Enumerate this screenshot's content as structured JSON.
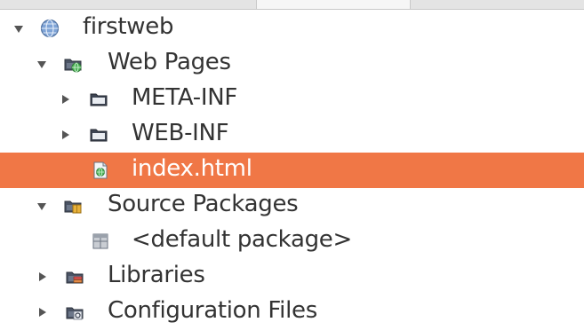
{
  "tree": {
    "items": [
      {
        "label": "firstweb"
      },
      {
        "label": "Web Pages"
      },
      {
        "label": "META-INF"
      },
      {
        "label": "WEB-INF"
      },
      {
        "label": "index.html"
      },
      {
        "label": "Source Packages"
      },
      {
        "label": "<default package>"
      },
      {
        "label": "Libraries"
      },
      {
        "label": "Configuration Files"
      }
    ]
  },
  "colors": {
    "selection": "#f07746",
    "text": "#333333",
    "selected_text": "#ffffff"
  }
}
